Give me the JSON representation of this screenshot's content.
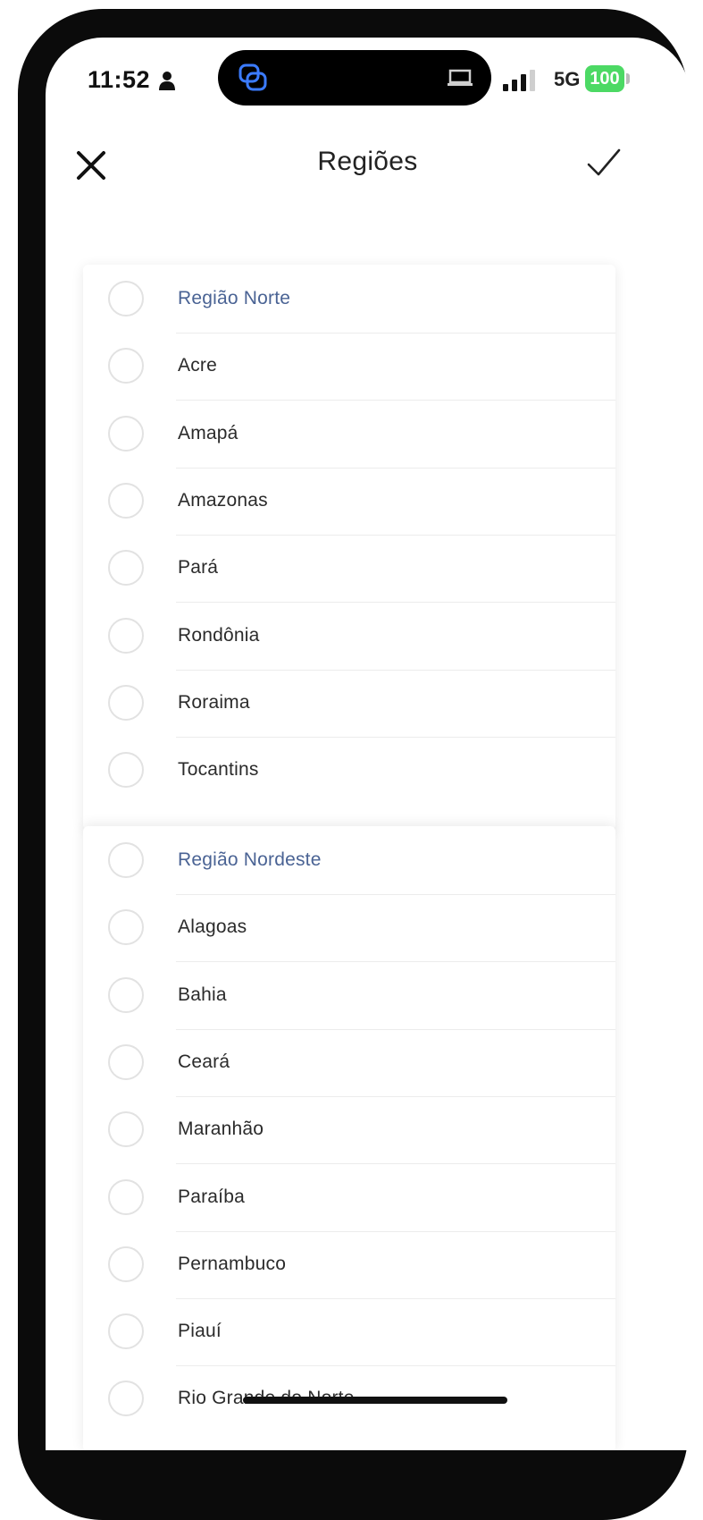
{
  "status_bar": {
    "time": "11:52",
    "network": "5G",
    "battery": "100",
    "battery_color": "#4cd964"
  },
  "header": {
    "title": "Regiões",
    "close_icon": "close-icon",
    "confirm_icon": "check-icon"
  },
  "accent_color": "#4a6394",
  "groups": [
    {
      "label": "Região Norte",
      "items": [
        "Acre",
        "Amapá",
        "Amazonas",
        "Pará",
        "Rondônia",
        "Roraima",
        "Tocantins"
      ]
    },
    {
      "label": "Região Nordeste",
      "items": [
        "Alagoas",
        "Bahia",
        "Ceará",
        "Maranhão",
        "Paraíba",
        "Pernambuco",
        "Piauí",
        "Rio Grande do Norte"
      ]
    }
  ]
}
